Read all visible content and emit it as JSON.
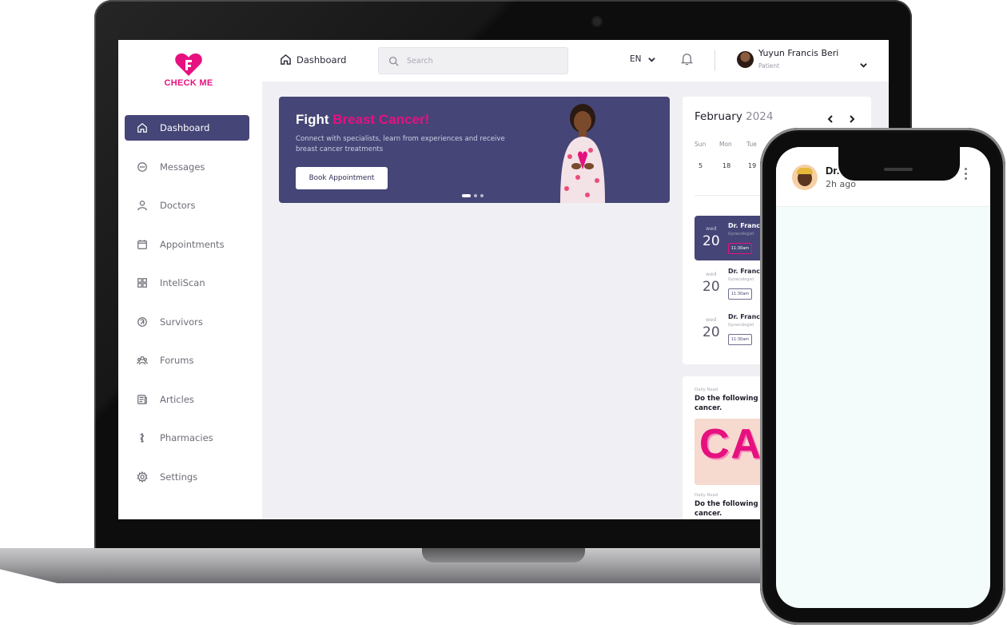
{
  "app": {
    "name": "CHECK ME",
    "brand_color": "#e6117f",
    "primary_color": "#454577"
  },
  "sidebar": {
    "items": [
      {
        "label": "Dashboard",
        "icon": "home-icon",
        "active": true
      },
      {
        "label": "Messages",
        "icon": "chat-icon"
      },
      {
        "label": "Doctors",
        "icon": "doctor-icon"
      },
      {
        "label": "Appointments",
        "icon": "calendar-icon"
      },
      {
        "label": "InteliScan",
        "icon": "scan-icon"
      },
      {
        "label": "Survivors",
        "icon": "ribbon-icon"
      },
      {
        "label": "Forums",
        "icon": "group-icon"
      },
      {
        "label": "Articles",
        "icon": "article-icon"
      },
      {
        "label": "Pharmacies",
        "icon": "pharmacy-icon"
      },
      {
        "label": "Settings",
        "icon": "gear-icon"
      }
    ]
  },
  "header": {
    "breadcrumb": "Dashboard",
    "search_placeholder": "Search",
    "language": "EN",
    "user": {
      "name": "Yuyun Francis Beri",
      "role": "Patient"
    }
  },
  "banner": {
    "title_prefix": "Fight",
    "title_accent": "Breast Cancer!",
    "subtitle": "Connect with specialists, learn from experiences and receive breast cancer treatments",
    "button": "Book Appointment",
    "slides": 3,
    "active_slide": 1
  },
  "calendar": {
    "month": "February",
    "year": "2024",
    "days": [
      "Sun",
      "Mon",
      "Tue"
    ],
    "dates": [
      "5",
      "18",
      "19"
    ]
  },
  "appointments": [
    {
      "dow": "wed",
      "day": "20",
      "doctor": "Dr. Francis",
      "specialty": "Gynecologist",
      "time": "11:30am",
      "active": true
    },
    {
      "dow": "wed",
      "day": "20",
      "doctor": "Dr. Francis",
      "specialty": "Gynecologist",
      "time": "11:30am"
    },
    {
      "dow": "wed",
      "day": "20",
      "doctor": "Dr. Francis",
      "specialty": "Gynecologist",
      "time": "11:30am"
    }
  ],
  "articles": [
    {
      "label": "Daily Read",
      "title": "Do the following things to ... breast cancer."
    },
    {
      "label": "Daily Read",
      "title": "Do the following things to ... breast cancer."
    }
  ],
  "article_image_text": "CA",
  "phone": {
    "contact_name": "Dr. Joseph Thigiti",
    "last_seen": "2h ago"
  }
}
